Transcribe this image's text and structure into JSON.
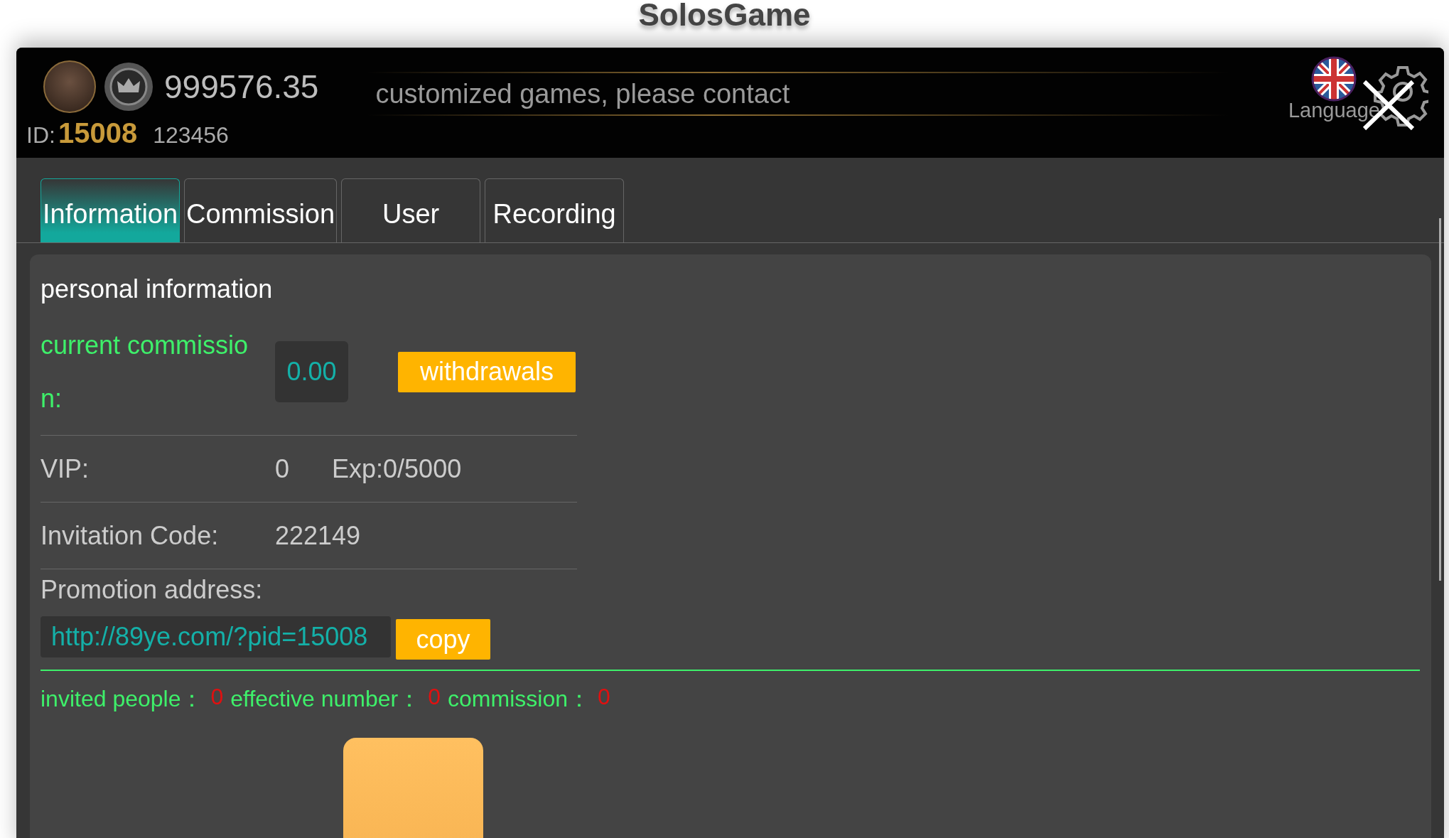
{
  "page_title": "SolosGame",
  "header": {
    "balance": "999576.35",
    "marquee": "customized games, please contact",
    "id_label": "ID:",
    "id_value": "15008",
    "account": "123456",
    "language_label": "Language"
  },
  "tabs": [
    {
      "label": "Information",
      "selected": true
    },
    {
      "label": "Commission",
      "selected": false
    },
    {
      "label": "User",
      "selected": false
    },
    {
      "label": "Recording",
      "selected": false
    }
  ],
  "section_title": "personal information",
  "commission": {
    "label": "current commission:",
    "value": "0.00",
    "button": "withdrawals"
  },
  "vip": {
    "label": "VIP:",
    "level": "0",
    "exp": "Exp:0/5000"
  },
  "invitation": {
    "label": "Invitation Code:",
    "value": "222149"
  },
  "promotion": {
    "label": "Promotion address:",
    "url": "http://89ye.com/?pid=15008",
    "button": "copy"
  },
  "stats": [
    {
      "label": "invited people：",
      "value": "0"
    },
    {
      "label": "effective number：",
      "value": "0"
    },
    {
      "label": "commission：",
      "value": "0"
    }
  ]
}
